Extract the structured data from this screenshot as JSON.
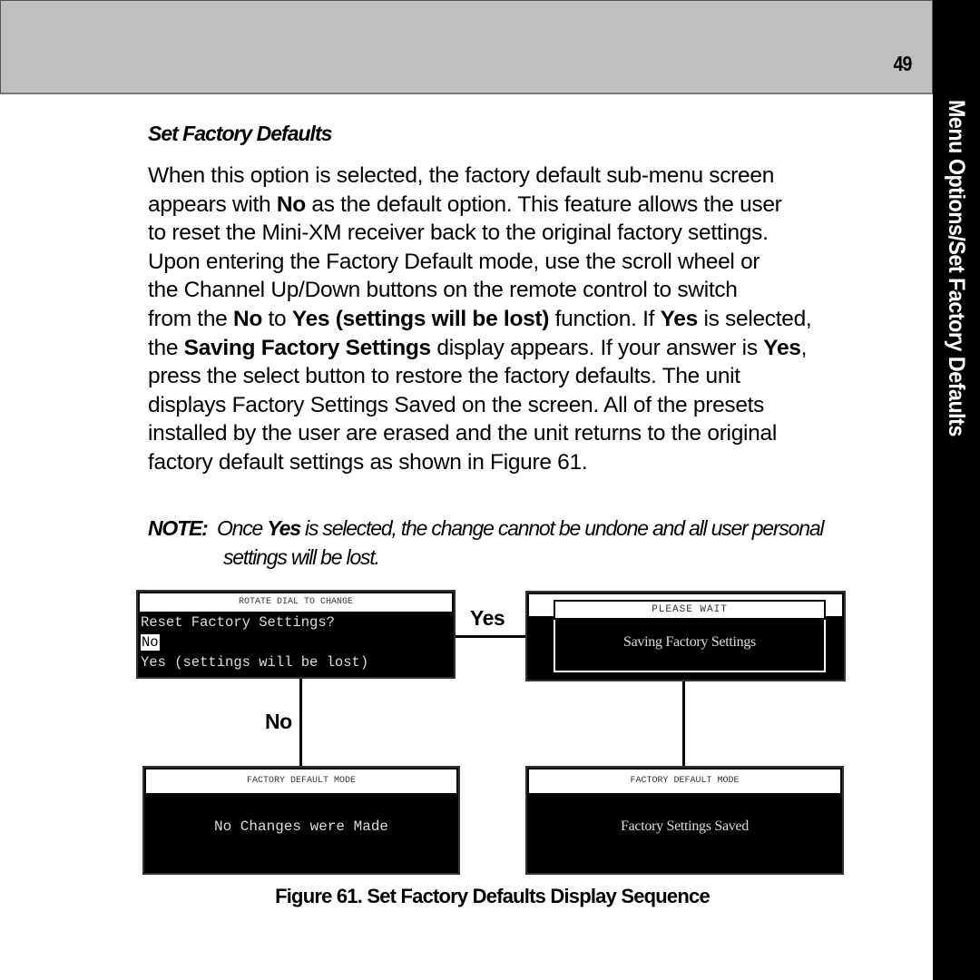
{
  "header": {
    "page_number": "49"
  },
  "side_tab": {
    "label": "Menu Options/Set Factory Defaults"
  },
  "section": {
    "title": "Set Factory Defaults"
  },
  "body": {
    "lines": [
      [
        "When this option is selected, the factory default  sub-menu screen"
      ],
      [
        "appears with ",
        {
          "b": "No"
        },
        " as the default option. This feature allows the user"
      ],
      [
        "to reset the Mini-XM receiver back to the original factory settings."
      ],
      [
        "Upon entering the Factory Default mode, use the scroll wheel or"
      ],
      [
        "the Channel Up/Down buttons on the remote control to switch"
      ],
      [
        "from the ",
        {
          "b": "No"
        },
        " to ",
        {
          "b": "Yes (settings will be lost)"
        },
        " function. If  ",
        {
          "b": "Yes"
        },
        " is selected,"
      ],
      [
        "the ",
        {
          "b": "Saving Factory Settings"
        },
        " display appears. If your answer is ",
        {
          "b": "Yes"
        },
        ","
      ],
      [
        "press the select button to restore the factory defaults. The unit"
      ],
      [
        "displays Factory Settings Saved  on the screen. All of the presets"
      ],
      [
        "installed by the user are erased and the unit returns to the original"
      ],
      [
        "factory default settings as shown in Figure 61."
      ]
    ]
  },
  "note": {
    "label": "NOTE:",
    "line1_pre": "Once ",
    "line1_bold": "Yes",
    "line1_post": " is selected, the change cannot be undone and all user personal",
    "line2": "settings will be lost."
  },
  "figure": {
    "screen_prompt": {
      "header": "ROTATE DIAL TO CHANGE",
      "question": "Reset Factory Settings?",
      "option_selected": "No",
      "option_other": "Yes (settings will be lost)"
    },
    "screen_saving": {
      "header": "PLEASE  WAIT",
      "message": "Saving Factory Settings"
    },
    "screen_no_change": {
      "header": "FACTORY DEFAULT MODE",
      "message": "No Changes were Made"
    },
    "screen_saved": {
      "header": "FACTORY DEFAULT MODE",
      "message": "Factory Settings Saved"
    },
    "branch_yes": "Yes",
    "branch_no": "No",
    "caption": "Figure 61. Set Factory Defaults Display Sequence"
  }
}
